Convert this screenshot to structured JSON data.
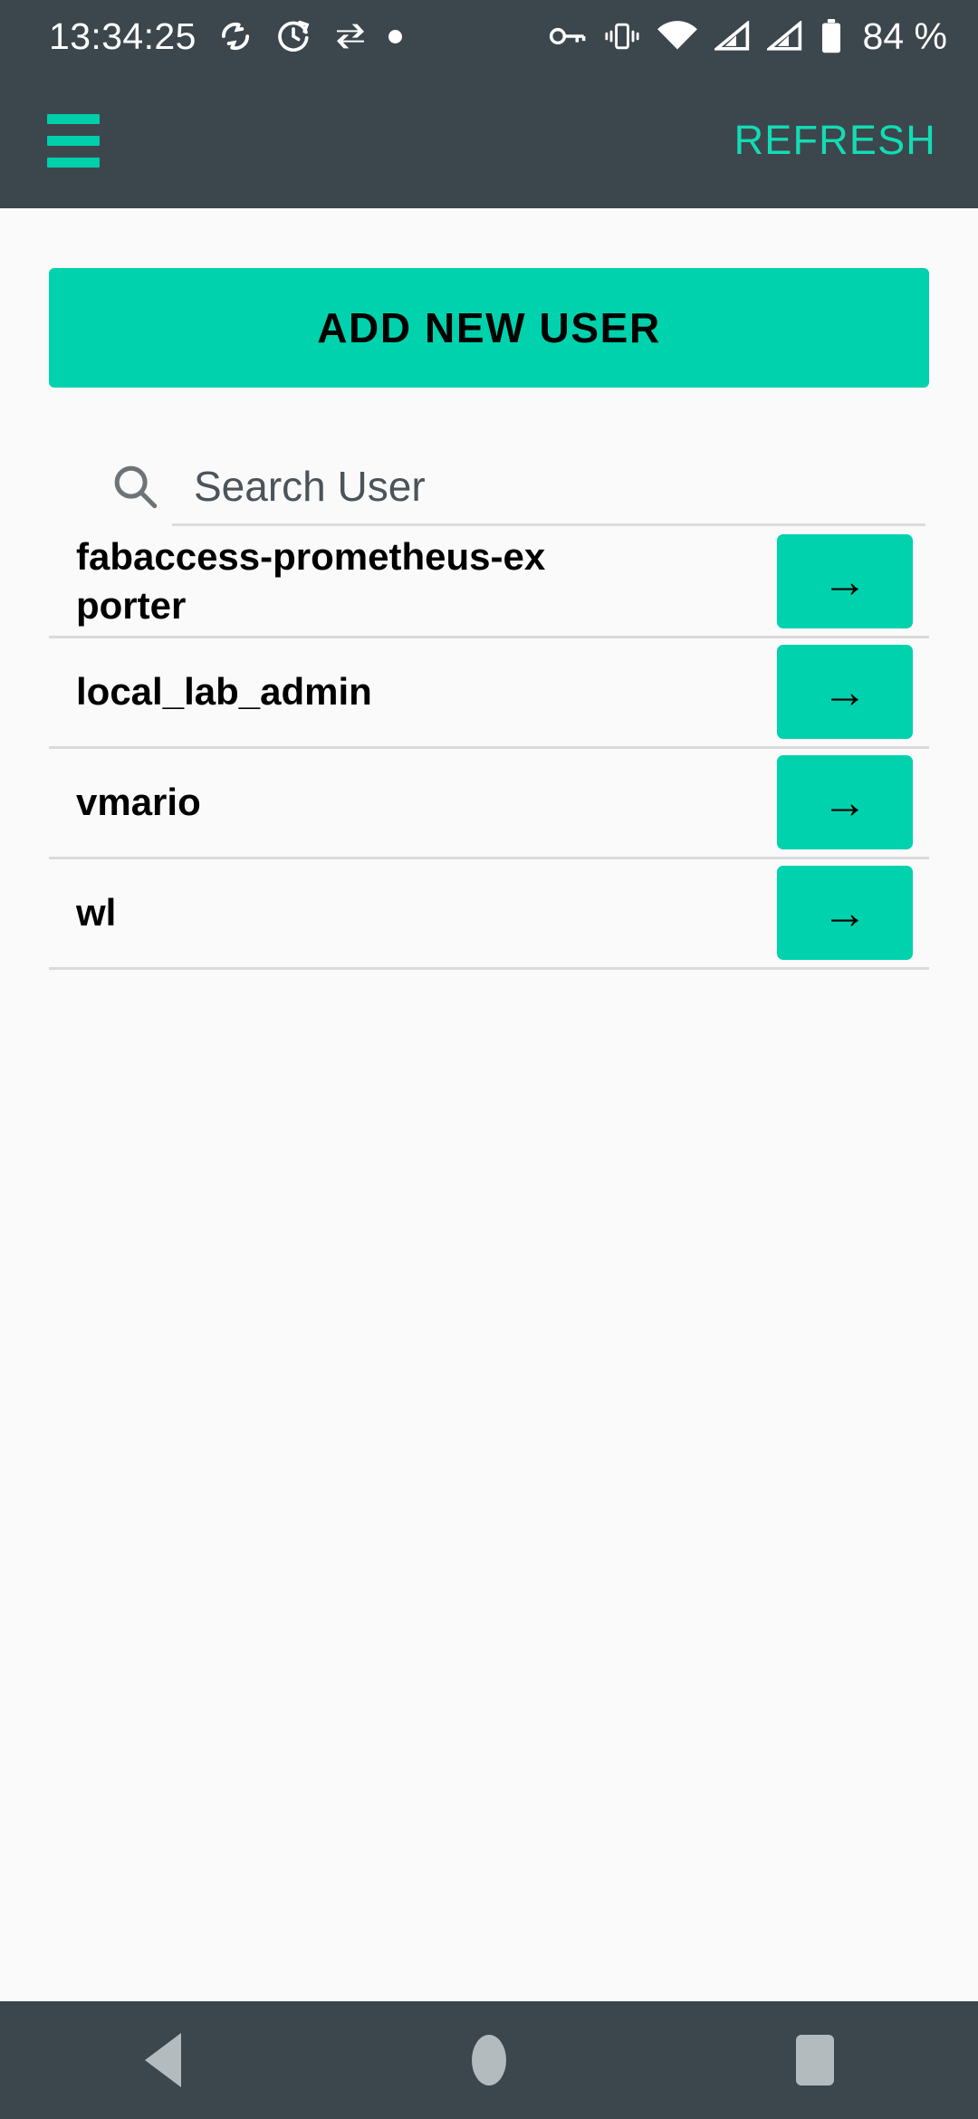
{
  "status_bar": {
    "time": "13:34:25",
    "battery_percent": "84 %",
    "left_icons": [
      "sync-icon",
      "alarm-timer-icon",
      "data-transfer-icon",
      "dot-indicator-icon"
    ],
    "right_icons": [
      "vpn-key-icon",
      "vibrate-icon",
      "wifi-icon",
      "cellular-signal-1-icon",
      "cellular-signal-2-icon",
      "battery-icon"
    ],
    "background_color": "#3c474d",
    "foreground_color": "#ffffff"
  },
  "app_bar": {
    "menu_icon": "hamburger-menu-icon",
    "refresh_label": "REFRESH",
    "background_color": "#3c474d",
    "accent_color": "#00cfab"
  },
  "main": {
    "add_user_label": "ADD NEW USER",
    "search": {
      "icon": "search-icon",
      "value": "",
      "placeholder": "Search User"
    },
    "users": [
      {
        "name": "fabaccess-prometheus-exporter",
        "arrow": "→"
      },
      {
        "name": "local_lab_admin",
        "arrow": "→"
      },
      {
        "name": "vmario",
        "arrow": "→"
      },
      {
        "name": "wl",
        "arrow": "→"
      }
    ],
    "background_color": "#fafafa",
    "accent_color": "#00d2ad"
  },
  "nav_bar": {
    "items": [
      "back-button",
      "home-button",
      "recents-button"
    ],
    "background_color": "#3c474d",
    "icon_color": "#b4bbbf"
  }
}
